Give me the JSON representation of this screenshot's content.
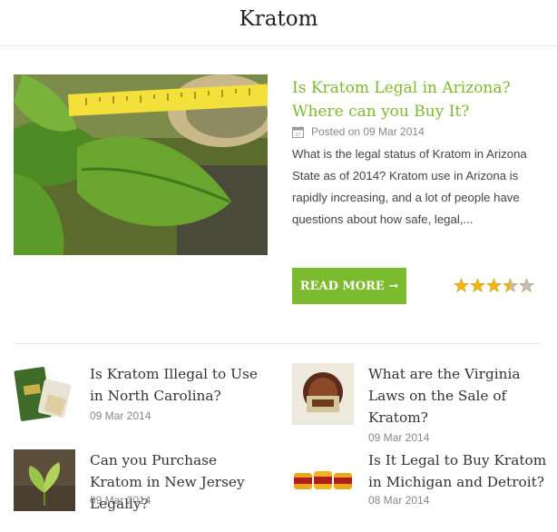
{
  "header": {
    "site_title": "Kratom"
  },
  "featured": {
    "title": "Is Kratom Legal in Arizona? Where can you Buy It?",
    "meta": "Posted on 09 Mar 2014",
    "excerpt": "What is the legal status of Kratom in Arizona State as of 2014? Kratom use in Arizona is rapidly increasing, and a lot of people have questions about how safe, legal,...",
    "read_more_label": "READ MORE →",
    "rating": 3.5,
    "rating_max": 5
  },
  "posts": [
    {
      "title": "Is Kratom Illegal to Use in North Carolina?",
      "date": "09 Mar 2014"
    },
    {
      "title": "What are the Virginia Laws on the Sale of Kratom?",
      "date": "09 Mar 2014"
    },
    {
      "title": "Can you Purchase Kratom in New Jersey Legally?",
      "date": "09 Mar 2014"
    },
    {
      "title": "Is It Legal to Buy Kratom in Michigan and Detroit?",
      "date": "08 Mar 2014"
    }
  ],
  "colors": {
    "accent": "#7cba2e",
    "star": "#f2b50f",
    "star_empty": "#bdbdbd"
  }
}
